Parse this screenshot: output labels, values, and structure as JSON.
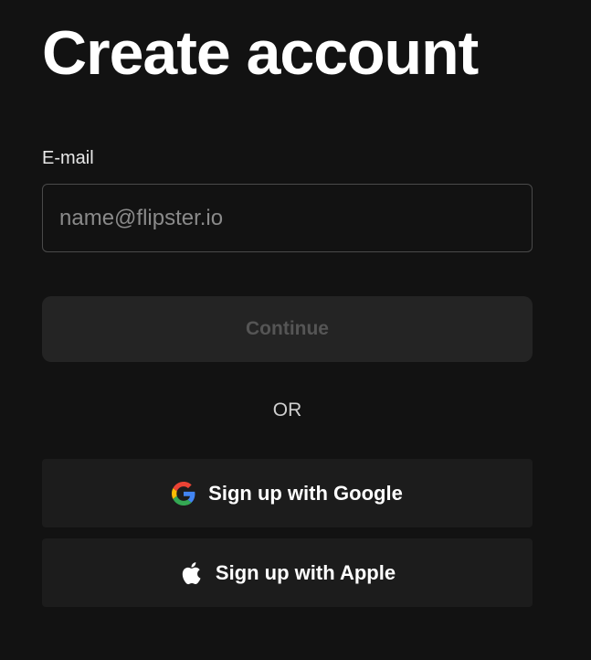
{
  "header": {
    "title": "Create account"
  },
  "form": {
    "email_label": "E-mail",
    "email_value": "",
    "email_placeholder": "name@flipster.io",
    "continue_label": "Continue"
  },
  "divider": {
    "or_text": "OR"
  },
  "social": {
    "google": {
      "label": "Sign up with Google",
      "icon": "google-icon"
    },
    "apple": {
      "label": "Sign up with Apple",
      "icon": "apple-icon"
    }
  },
  "colors": {
    "background": "#121212",
    "input_border": "#4a4a4a",
    "button_disabled_bg": "#242424",
    "button_disabled_text": "#555555",
    "social_bg": "#1c1c1c",
    "text_primary": "#ffffff"
  }
}
